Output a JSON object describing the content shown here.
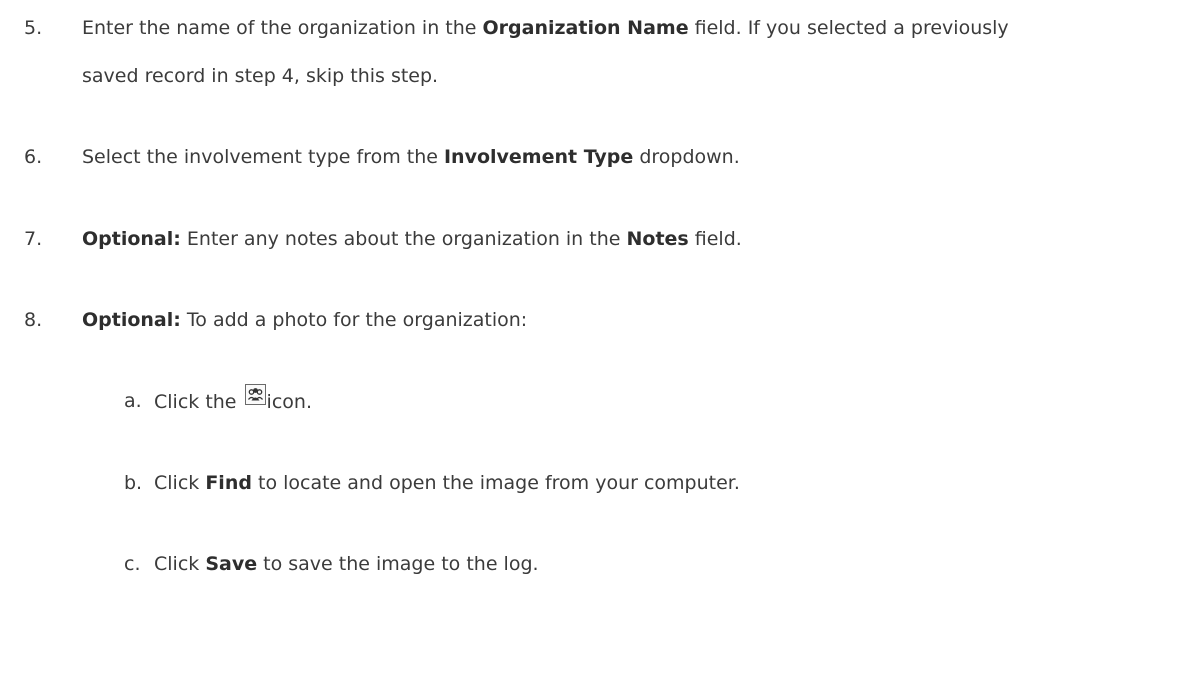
{
  "steps": [
    {
      "number": "5.",
      "line1_pre": "Enter the name of the organization in the ",
      "line1_bold": "Organization Name",
      "line1_post": " field. If you selected a previously",
      "line2": "saved record in step 4, skip this step."
    },
    {
      "number": "6.",
      "pre": "Select the involvement type from the ",
      "bold": "Involvement Type",
      "post": " dropdown."
    },
    {
      "number": "7.",
      "bold1": "Optional:",
      "pre": " Enter any notes about the organization in the ",
      "bold2": "Notes",
      "post": " field."
    },
    {
      "number": "8.",
      "bold": "Optional:",
      "post": " To add a photo for the organization:"
    }
  ],
  "substeps": [
    {
      "letter": "a.",
      "pre": "Click the ",
      "icon": "group-photo-icon",
      "post": "icon."
    },
    {
      "letter": "b.",
      "pre": "Click ",
      "bold": "Find",
      "post": " to locate and open the image from your computer."
    },
    {
      "letter": "c.",
      "pre": "Click ",
      "bold": "Save",
      "post": " to save the image to the log."
    }
  ]
}
